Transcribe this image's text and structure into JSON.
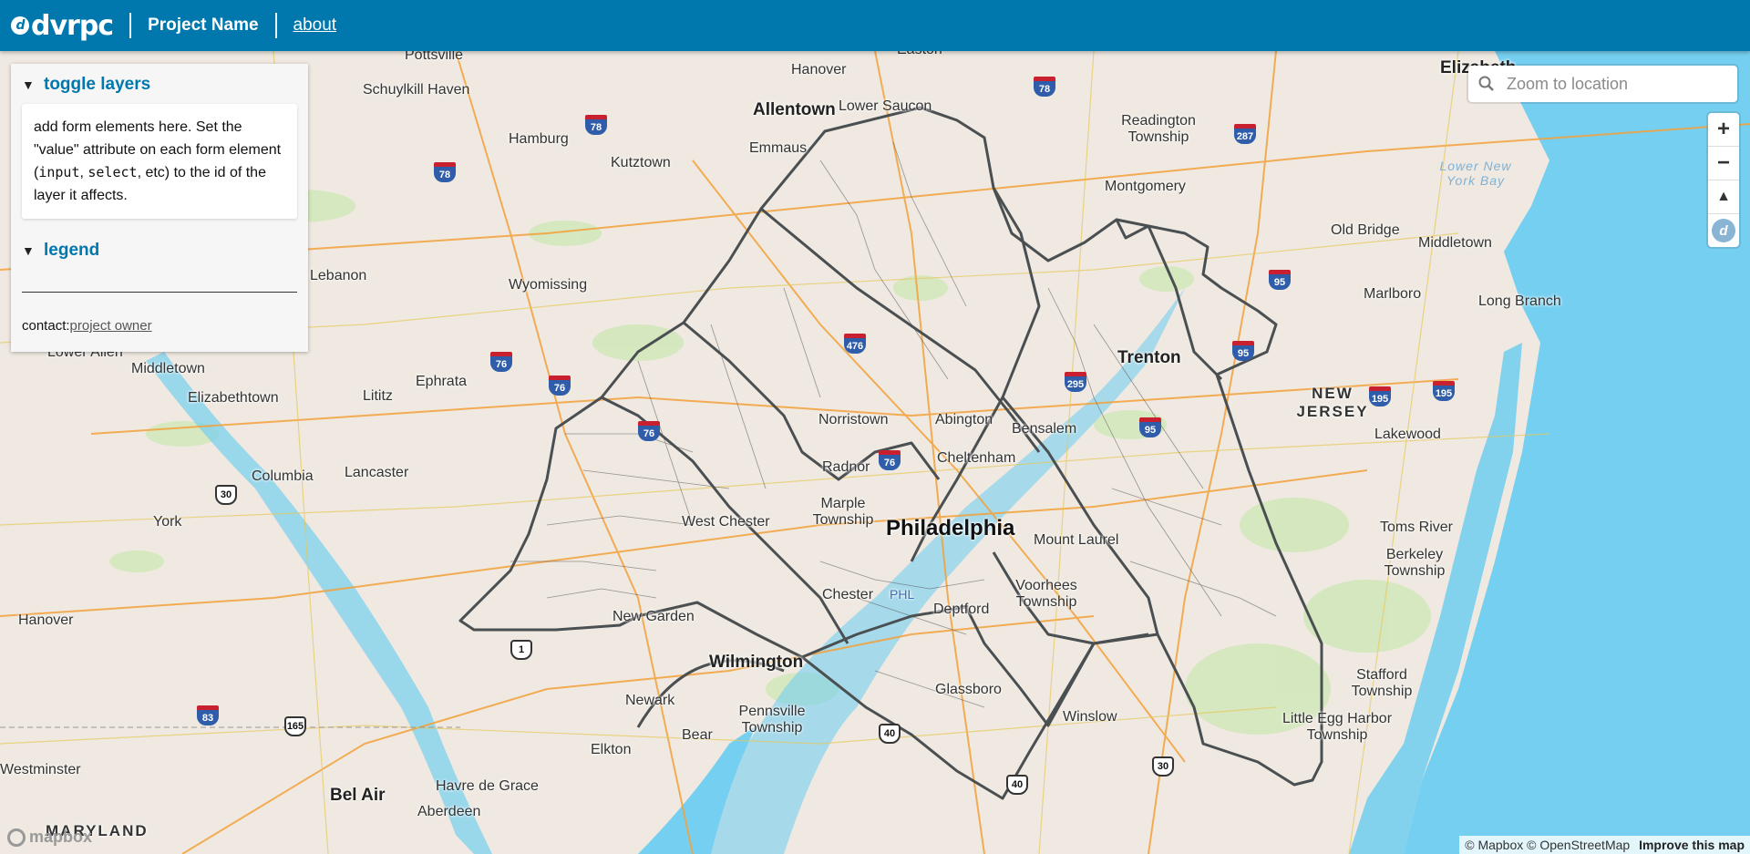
{
  "header": {
    "logo_text": "dvrpc",
    "project_name": "Project Name",
    "about_link": "about"
  },
  "sidebar": {
    "toggle_section": {
      "title": "toggle layers",
      "text_1": "add form elements here. Set the \"value\" attribute on each form element (",
      "code_input": "input",
      "text_comma": ", ",
      "code_select": "select",
      "text_2": ", etc) to the id of the layer it affects."
    },
    "legend_section": {
      "title": "legend"
    },
    "contact_label": "contact:",
    "contact_link": "project owner",
    "expanded_glyph": "▼"
  },
  "search": {
    "placeholder": "Zoom to location",
    "icon": "search-icon"
  },
  "controls": {
    "zoom_in": "+",
    "zoom_out": "−",
    "compass": "▲"
  },
  "attribution": {
    "mapbox": "© Mapbox",
    "osm": "© OpenStreetMap",
    "improve": "Improve this map"
  },
  "map_labels": {
    "cities": [
      "Pottsville",
      "Schuylkill Haven",
      "Hanover",
      "Easton",
      "Elizabeth",
      "Allentown",
      "Lower Saucon",
      "Readington Township",
      "Hamburg",
      "Emmaus",
      "Kutztown",
      "Montgomery",
      "Old Bridge",
      "Middletown",
      "Marlboro",
      "Long Branch",
      "Wyomissing",
      "Lebanon",
      "Trenton",
      "Lower Allen",
      "Middletown",
      "Ephrata",
      "Elizabethtown",
      "Lititz",
      "Norristown",
      "Abington",
      "Bensalem",
      "Cheltenham",
      "Radnor",
      "Columbia",
      "Lancaster",
      "Marple Township",
      "West Chester",
      "Philadelphia",
      "Lakewood",
      "Mount Laurel",
      "Toms River",
      "York",
      "Berkeley Township",
      "Voorhees Township",
      "Chester",
      "Deptford",
      "Hanover",
      "New Garden",
      "Wilmington",
      "Newark",
      "Stafford Township",
      "Glassboro",
      "Little Egg Harbor Township",
      "Pennsville Township",
      "Winslow",
      "Bear",
      "Elkton",
      "Westminster",
      "Bel Air",
      "Havre de Grace",
      "Aberdeen",
      "MARYLAND",
      "NEW JERSEY",
      "Lower New York Bay",
      "PHL"
    ],
    "interstates": [
      "78",
      "78",
      "78",
      "287",
      "476",
      "76",
      "76",
      "76",
      "95",
      "95",
      "195",
      "195",
      "295",
      "95",
      "83"
    ],
    "us_routes": [
      "30",
      "1",
      "40",
      "40",
      "30",
      "165"
    ]
  },
  "colors": {
    "header": "#0078ae",
    "title": "#0078ae",
    "water": "#75cff0",
    "land": "#efe9e1",
    "border": "#4a4f52"
  }
}
